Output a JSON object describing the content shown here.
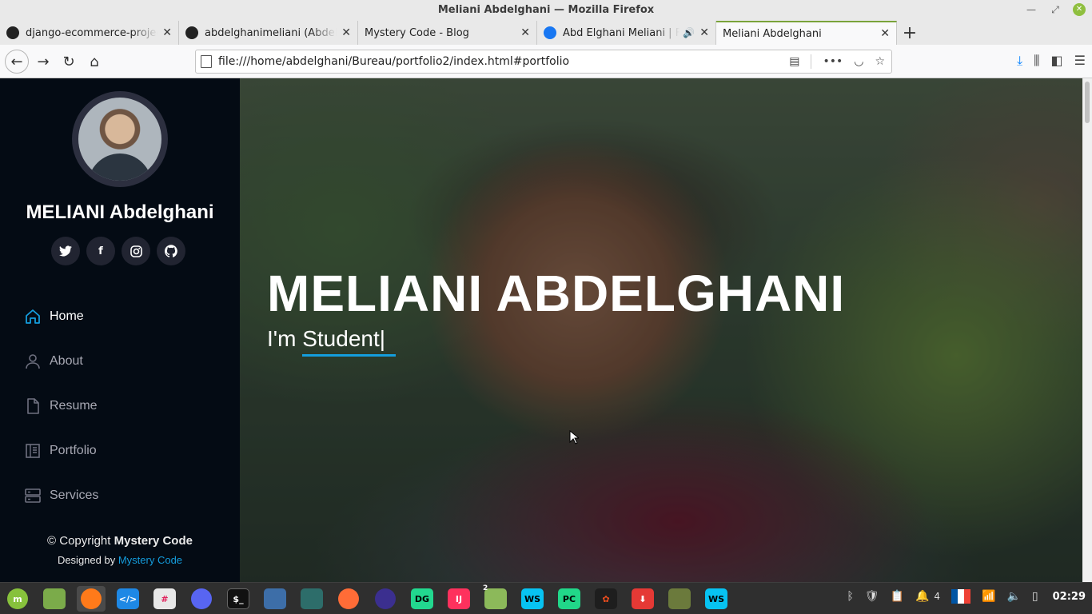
{
  "window": {
    "title": "Meliani Abdelghani — Mozilla Firefox"
  },
  "tabs": [
    {
      "label": "django-ecommerce-project:",
      "icon": "github-icon"
    },
    {
      "label": "abdelghanimeliani (Abdelgh",
      "icon": "github-icon"
    },
    {
      "label": "Mystery Code - Blog",
      "icon": ""
    },
    {
      "label": "Abd Elghani Meliani | Fac",
      "icon": "facebook-icon",
      "sound": true
    },
    {
      "label": "Meliani Abdelghani",
      "icon": "",
      "active": true
    }
  ],
  "nav": {
    "url": "file:///home/abdelghani/Bureau/portfolio2/index.html#portfolio"
  },
  "sidebar": {
    "name": "MELIANI Abdelghani",
    "social": [
      "twitter-icon",
      "facebook-icon",
      "instagram-icon",
      "github-icon"
    ],
    "menu": [
      {
        "label": "Home",
        "icon": "home-icon",
        "active": true
      },
      {
        "label": "About",
        "icon": "user-icon"
      },
      {
        "label": "Resume",
        "icon": "file-icon"
      },
      {
        "label": "Portfolio",
        "icon": "book-icon"
      },
      {
        "label": "Services",
        "icon": "server-icon"
      }
    ],
    "footer": {
      "copyright_prefix": "© Copyright",
      "copyright_brand": "Mystery Code",
      "designed_prefix": "Designed by",
      "designed_brand": "Mystery Code"
    }
  },
  "hero": {
    "title": "MELIANI ABDELGHANI",
    "subtitle": "I'm Student|"
  },
  "taskbar": {
    "apps": [
      "mint-menu-icon",
      "files-icon",
      "firefox-icon",
      "vscode-icon",
      "slack-icon",
      "discord-icon",
      "terminal-icon",
      "camera-icon",
      "android-studio-icon",
      "postman-icon",
      "eclipse-icon",
      "datagrip-icon",
      "intellij-icon",
      "folder-icon",
      "webstorm-icon",
      "pycharm-icon",
      "figma-icon",
      "downloader-icon",
      "hardware-icon",
      "webstorm-icon-2"
    ],
    "folder_badge": "2",
    "notification_count": "4",
    "clock": "02:29"
  }
}
